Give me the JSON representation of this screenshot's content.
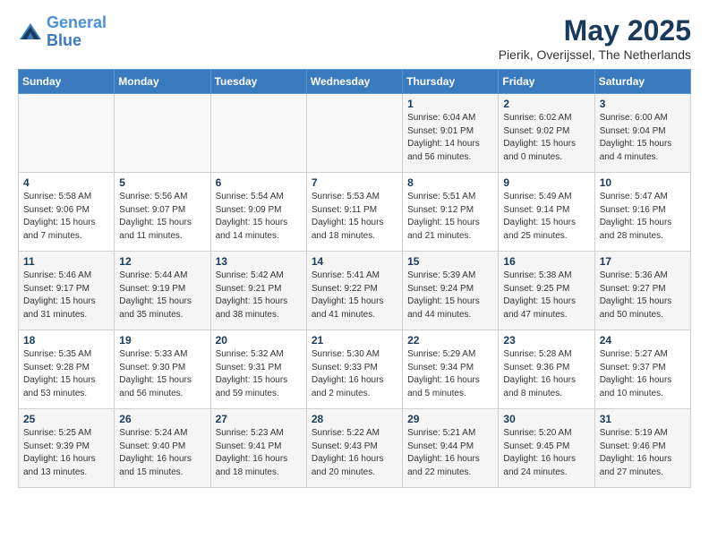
{
  "logo": {
    "line1": "General",
    "line2": "Blue"
  },
  "title": "May 2025",
  "subtitle": "Pierik, Overijssel, The Netherlands",
  "headers": [
    "Sunday",
    "Monday",
    "Tuesday",
    "Wednesday",
    "Thursday",
    "Friday",
    "Saturday"
  ],
  "weeks": [
    [
      {
        "day": "",
        "info": ""
      },
      {
        "day": "",
        "info": ""
      },
      {
        "day": "",
        "info": ""
      },
      {
        "day": "",
        "info": ""
      },
      {
        "day": "1",
        "info": "Sunrise: 6:04 AM\nSunset: 9:01 PM\nDaylight: 14 hours\nand 56 minutes."
      },
      {
        "day": "2",
        "info": "Sunrise: 6:02 AM\nSunset: 9:02 PM\nDaylight: 15 hours\nand 0 minutes."
      },
      {
        "day": "3",
        "info": "Sunrise: 6:00 AM\nSunset: 9:04 PM\nDaylight: 15 hours\nand 4 minutes."
      }
    ],
    [
      {
        "day": "4",
        "info": "Sunrise: 5:58 AM\nSunset: 9:06 PM\nDaylight: 15 hours\nand 7 minutes."
      },
      {
        "day": "5",
        "info": "Sunrise: 5:56 AM\nSunset: 9:07 PM\nDaylight: 15 hours\nand 11 minutes."
      },
      {
        "day": "6",
        "info": "Sunrise: 5:54 AM\nSunset: 9:09 PM\nDaylight: 15 hours\nand 14 minutes."
      },
      {
        "day": "7",
        "info": "Sunrise: 5:53 AM\nSunset: 9:11 PM\nDaylight: 15 hours\nand 18 minutes."
      },
      {
        "day": "8",
        "info": "Sunrise: 5:51 AM\nSunset: 9:12 PM\nDaylight: 15 hours\nand 21 minutes."
      },
      {
        "day": "9",
        "info": "Sunrise: 5:49 AM\nSunset: 9:14 PM\nDaylight: 15 hours\nand 25 minutes."
      },
      {
        "day": "10",
        "info": "Sunrise: 5:47 AM\nSunset: 9:16 PM\nDaylight: 15 hours\nand 28 minutes."
      }
    ],
    [
      {
        "day": "11",
        "info": "Sunrise: 5:46 AM\nSunset: 9:17 PM\nDaylight: 15 hours\nand 31 minutes."
      },
      {
        "day": "12",
        "info": "Sunrise: 5:44 AM\nSunset: 9:19 PM\nDaylight: 15 hours\nand 35 minutes."
      },
      {
        "day": "13",
        "info": "Sunrise: 5:42 AM\nSunset: 9:21 PM\nDaylight: 15 hours\nand 38 minutes."
      },
      {
        "day": "14",
        "info": "Sunrise: 5:41 AM\nSunset: 9:22 PM\nDaylight: 15 hours\nand 41 minutes."
      },
      {
        "day": "15",
        "info": "Sunrise: 5:39 AM\nSunset: 9:24 PM\nDaylight: 15 hours\nand 44 minutes."
      },
      {
        "day": "16",
        "info": "Sunrise: 5:38 AM\nSunset: 9:25 PM\nDaylight: 15 hours\nand 47 minutes."
      },
      {
        "day": "17",
        "info": "Sunrise: 5:36 AM\nSunset: 9:27 PM\nDaylight: 15 hours\nand 50 minutes."
      }
    ],
    [
      {
        "day": "18",
        "info": "Sunrise: 5:35 AM\nSunset: 9:28 PM\nDaylight: 15 hours\nand 53 minutes."
      },
      {
        "day": "19",
        "info": "Sunrise: 5:33 AM\nSunset: 9:30 PM\nDaylight: 15 hours\nand 56 minutes."
      },
      {
        "day": "20",
        "info": "Sunrise: 5:32 AM\nSunset: 9:31 PM\nDaylight: 15 hours\nand 59 minutes."
      },
      {
        "day": "21",
        "info": "Sunrise: 5:30 AM\nSunset: 9:33 PM\nDaylight: 16 hours\nand 2 minutes."
      },
      {
        "day": "22",
        "info": "Sunrise: 5:29 AM\nSunset: 9:34 PM\nDaylight: 16 hours\nand 5 minutes."
      },
      {
        "day": "23",
        "info": "Sunrise: 5:28 AM\nSunset: 9:36 PM\nDaylight: 16 hours\nand 8 minutes."
      },
      {
        "day": "24",
        "info": "Sunrise: 5:27 AM\nSunset: 9:37 PM\nDaylight: 16 hours\nand 10 minutes."
      }
    ],
    [
      {
        "day": "25",
        "info": "Sunrise: 5:25 AM\nSunset: 9:39 PM\nDaylight: 16 hours\nand 13 minutes."
      },
      {
        "day": "26",
        "info": "Sunrise: 5:24 AM\nSunset: 9:40 PM\nDaylight: 16 hours\nand 15 minutes."
      },
      {
        "day": "27",
        "info": "Sunrise: 5:23 AM\nSunset: 9:41 PM\nDaylight: 16 hours\nand 18 minutes."
      },
      {
        "day": "28",
        "info": "Sunrise: 5:22 AM\nSunset: 9:43 PM\nDaylight: 16 hours\nand 20 minutes."
      },
      {
        "day": "29",
        "info": "Sunrise: 5:21 AM\nSunset: 9:44 PM\nDaylight: 16 hours\nand 22 minutes."
      },
      {
        "day": "30",
        "info": "Sunrise: 5:20 AM\nSunset: 9:45 PM\nDaylight: 16 hours\nand 24 minutes."
      },
      {
        "day": "31",
        "info": "Sunrise: 5:19 AM\nSunset: 9:46 PM\nDaylight: 16 hours\nand 27 minutes."
      }
    ]
  ]
}
